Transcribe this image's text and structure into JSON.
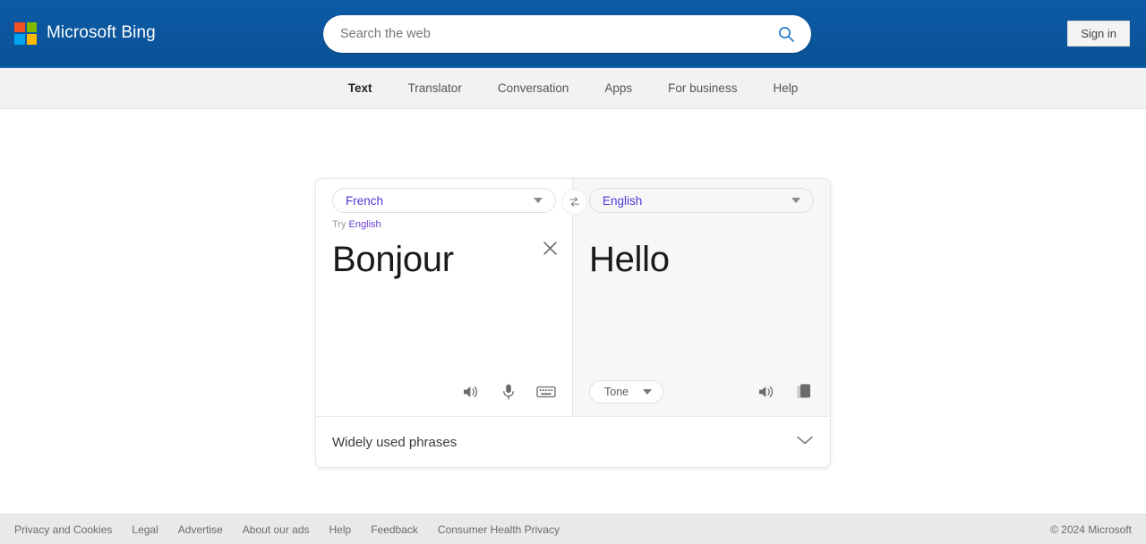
{
  "header": {
    "brand": "Microsoft Bing",
    "logo_colors": [
      "#f25022",
      "#7fba00",
      "#00a4ef",
      "#ffb900"
    ],
    "search": {
      "placeholder": "Search the web",
      "value": "",
      "icon": "search-icon",
      "icon_color": "#1a73c8"
    },
    "signin_label": "Sign in",
    "background_color": "#0c5aa6"
  },
  "nav": {
    "items": [
      {
        "label": "Text",
        "active": true
      },
      {
        "label": "Translator",
        "active": false
      },
      {
        "label": "Conversation",
        "active": false
      },
      {
        "label": "Apps",
        "active": false
      },
      {
        "label": "For business",
        "active": false
      },
      {
        "label": "Help",
        "active": false
      }
    ]
  },
  "translator": {
    "source": {
      "language": "French",
      "text": "Bonjour",
      "try_prefix": "Try",
      "try_language": "English",
      "clear_icon": "close-icon",
      "icons": [
        "speaker-icon",
        "microphone-icon",
        "keyboard-icon"
      ]
    },
    "target": {
      "language": "English",
      "text": "Hello",
      "tone_label": "Tone",
      "icons": [
        "speaker-icon",
        "copy-icon"
      ]
    },
    "swap_icon": "swap-languages-icon",
    "phrases_label": "Widely used phrases",
    "phrases_icon": "chevron-down-icon",
    "link_color": "#4b3bd4"
  },
  "footer": {
    "links": [
      "Privacy and Cookies",
      "Legal",
      "Advertise",
      "About our ads",
      "Help",
      "Feedback",
      "Consumer Health Privacy"
    ],
    "copyright": "© 2024 Microsoft"
  }
}
